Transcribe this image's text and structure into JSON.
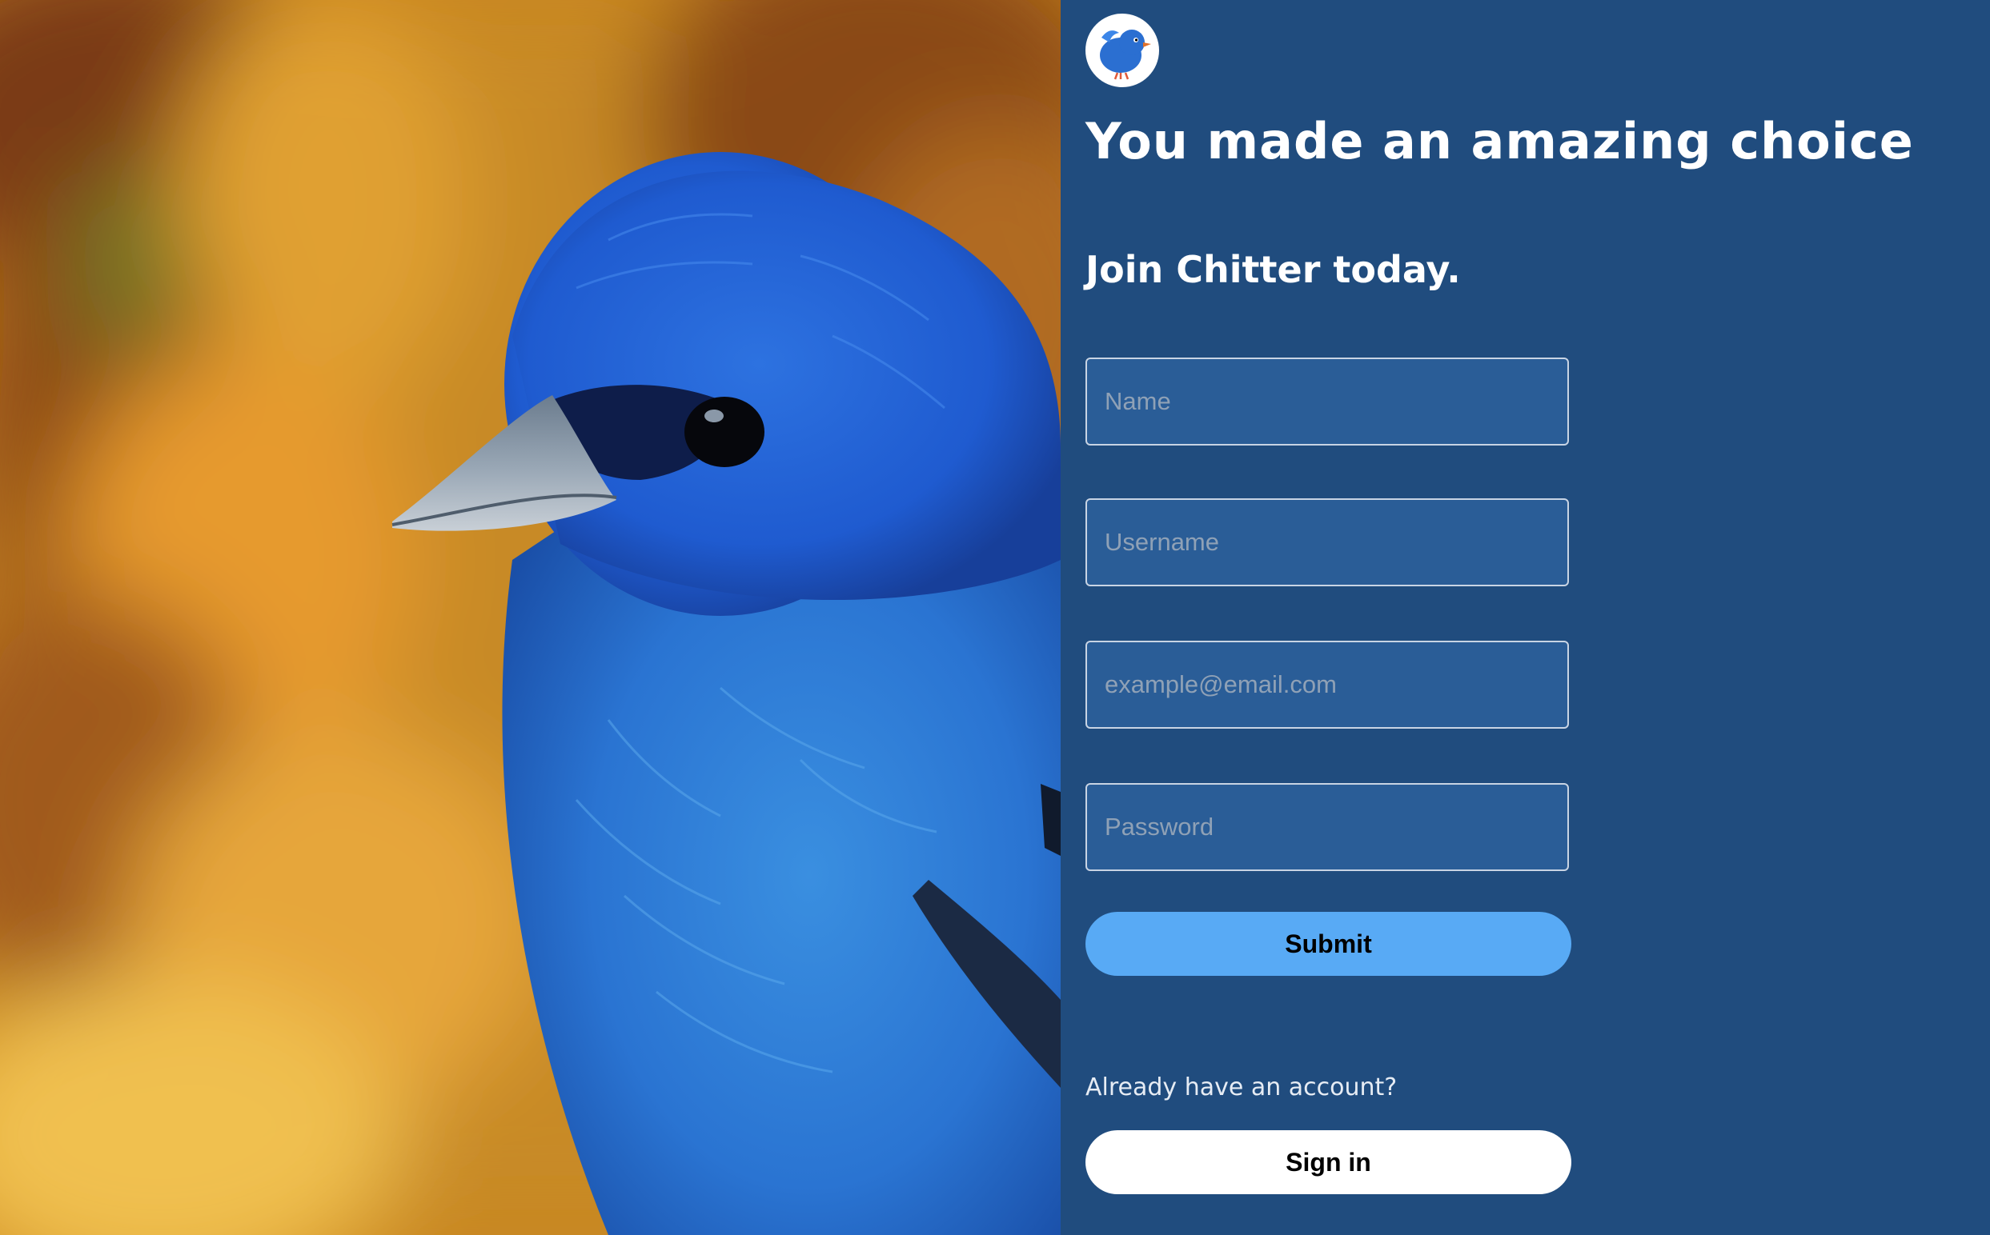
{
  "hero": {
    "image_description_icon": "blue-bird-photo"
  },
  "panel": {
    "logo_icon": "bird-logo-icon",
    "headline": "You made an amazing choice",
    "subheadline": "Join Chitter today.",
    "form": {
      "name_placeholder": "Name",
      "username_placeholder": "Username",
      "email_placeholder": "example@email.com",
      "password_placeholder": "Password",
      "submit_label": "Submit"
    },
    "already_text": "Already have an account?",
    "signin_label": "Sign in"
  },
  "colors": {
    "panel_bg": "#204c7e",
    "field_bg": "#2a5d97",
    "submit_bg": "#58aaf5",
    "signin_bg": "#ffffff"
  }
}
